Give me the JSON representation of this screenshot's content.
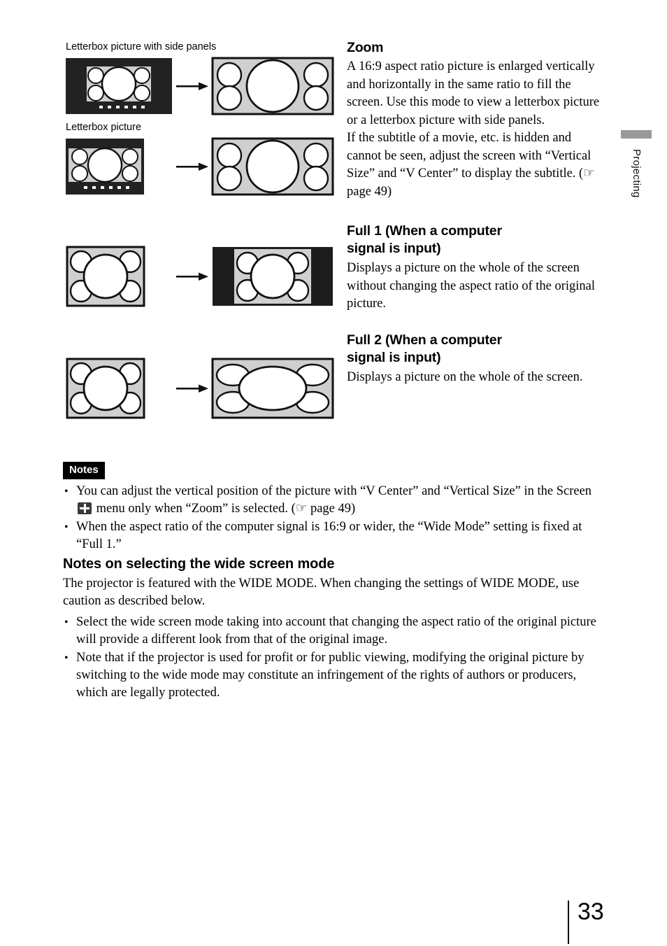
{
  "side_tab": {
    "label": "Projecting",
    "bar_color": "#999999"
  },
  "figures": {
    "label_1": "Letterbox picture with side panels",
    "label_2": "Letterbox picture",
    "arrow_icon": "right-arrow-icon"
  },
  "sections": [
    {
      "heading": "Zoom",
      "body": "A 16:9 aspect ratio picture is enlarged vertically and horizontally in the same ratio to fill the screen. Use this mode to view a letterbox picture or a letterbox picture with side panels."
    },
    {
      "heading_line_1": "Full 1 (When a computer",
      "heading_line_2": "signal is input)",
      "body": "Displays a picture on the whole of the screen without changing the aspect ratio of the original picture."
    },
    {
      "heading_line_1": "Full 2 (When a computer",
      "heading_line_2": "signal is input)",
      "body": "Displays a picture on the whole of the screen."
    }
  ],
  "zoom_body_2_pre": "If the subtitle of a movie, etc. is hidden and cannot be seen, adjust the screen with “Vertical Size” and “V Center” to display the subtitle. (",
  "zoom_body_2_ref": "☞",
  "zoom_body_2_post": " page 49)",
  "notes": {
    "tag": "Notes",
    "bullet_1_pre": "You can adjust the vertical position of the picture with “V Center” and “Vertical Size” in the Screen",
    "bullet_1_icon": "screen-menu-icon",
    "bullet_1_mid": "menu only when “Zoom” is selected. (",
    "bullet_1_ref": "☞",
    "bullet_1_post": " page 49)",
    "bullet_2": "When the aspect ratio of the computer signal is 16:9 or wider, the “Wide Mode” setting is fixed at “Full 1.”"
  },
  "wide_section": {
    "heading": "Notes on selecting the wide screen mode",
    "intro": "The projector is featured with the WIDE MODE. When changing the settings of WIDE MODE, use caution as described below.",
    "bullet_1": "Select the wide screen mode taking into account that changing the aspect ratio of the original picture will provide a different look from that of the original image.",
    "bullet_2": "Note that if the projector is used for profit or for public viewing, modifying the original picture by switching to the wide mode may constitute an infringement of the rights of authors or producers, which are legally protected."
  },
  "footer": {
    "page_number": "33"
  }
}
